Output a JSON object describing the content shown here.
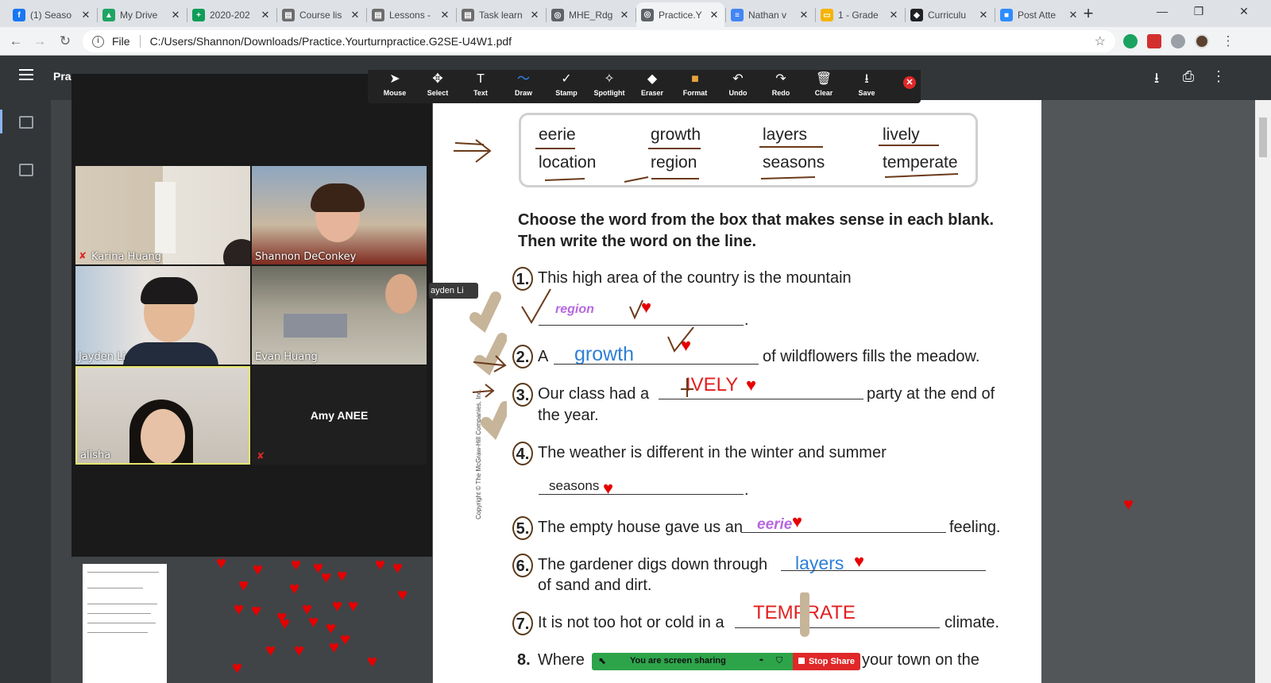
{
  "browser": {
    "tabs": [
      {
        "label": "(1) Seaso",
        "icon": "facebook-icon",
        "color": "#1877f2",
        "glyph": "f"
      },
      {
        "label": "My Drive",
        "icon": "drive-icon",
        "color": "#1fa463",
        "glyph": "▲"
      },
      {
        "label": "2020-202",
        "icon": "sheets-icon",
        "color": "#0f9d58",
        "glyph": "+"
      },
      {
        "label": "Course lis",
        "icon": "page-icon",
        "color": "#6d6d6d",
        "glyph": "▤"
      },
      {
        "label": "Lessons -",
        "icon": "page-icon",
        "color": "#6d6d6d",
        "glyph": "▤"
      },
      {
        "label": "Task learn",
        "icon": "page-icon",
        "color": "#6d6d6d",
        "glyph": "▤"
      },
      {
        "label": "MHE_Rdg",
        "icon": "globe-icon",
        "color": "#5f6368",
        "glyph": "◎"
      },
      {
        "label": "Practice.Y",
        "icon": "globe-icon",
        "color": "#5f6368",
        "glyph": "◎"
      },
      {
        "label": "Nathan v",
        "icon": "docs-icon",
        "color": "#4285f4",
        "glyph": "≡"
      },
      {
        "label": "1 - Grade",
        "icon": "slides-icon",
        "color": "#f4b400",
        "glyph": "▭"
      },
      {
        "label": "Curriculu",
        "icon": "curriculum-icon",
        "color": "#202124",
        "glyph": "◆"
      },
      {
        "label": "Post Atte",
        "icon": "zoom-icon",
        "color": "#2d8cff",
        "glyph": "■"
      }
    ],
    "file_label": "File",
    "url": "C:/Users/Shannon/Downloads/Practice.Yourturnpractice.G2SE-U4W1.pdf"
  },
  "pdf_title": "Prac",
  "zoom": {
    "participants": [
      {
        "name": "Karina Huang",
        "muted": true
      },
      {
        "name": "Shannon DeConkey",
        "muted": false
      },
      {
        "name": "Jayden Li",
        "muted": false
      },
      {
        "name": "Evan Huang",
        "muted": false
      },
      {
        "name": "alisha",
        "muted": false
      },
      {
        "name": "Amy ANEE",
        "muted": true
      }
    ],
    "tooltip": "ayden Li",
    "annotate_tools": [
      {
        "label": "Mouse",
        "icon": "cursor-icon",
        "glyph": "➤"
      },
      {
        "label": "Select",
        "icon": "move-icon",
        "glyph": "✥"
      },
      {
        "label": "Text",
        "icon": "text-icon",
        "glyph": "T"
      },
      {
        "label": "Draw",
        "icon": "draw-icon",
        "glyph": "〜",
        "selected": true
      },
      {
        "label": "Stamp",
        "icon": "check-icon",
        "glyph": "✓"
      },
      {
        "label": "Spotlight",
        "icon": "spotlight-icon",
        "glyph": "✧"
      },
      {
        "label": "Eraser",
        "icon": "eraser-icon",
        "glyph": "◆"
      },
      {
        "label": "Format",
        "icon": "format-icon",
        "glyph": "■"
      },
      {
        "label": "Undo",
        "icon": "undo-icon",
        "glyph": "↶"
      },
      {
        "label": "Redo",
        "icon": "redo-icon",
        "glyph": "↷"
      },
      {
        "label": "Clear",
        "icon": "trash-icon",
        "glyph": "🗑"
      },
      {
        "label": "Save",
        "icon": "save-icon",
        "glyph": "⭳"
      }
    ],
    "sharing_text": "You are screen sharing",
    "stop_share": "Stop Share"
  },
  "worksheet": {
    "words": [
      "eerie",
      "growth",
      "layers",
      "lively",
      "location",
      "region",
      "seasons",
      "temperate"
    ],
    "instructions": "Choose the word from the box that makes sense in each blank. Then write the word on the line.",
    "questions": [
      {
        "num": "1.",
        "before": "This high area of the country is the mountain",
        "after": ".",
        "answer": "region"
      },
      {
        "num": "2.",
        "before": "A",
        "after": "of wildflowers fills the meadow.",
        "answer": "growth"
      },
      {
        "num": "3.",
        "before": "Our class had a",
        "after": "party at the end of",
        "cont": "the year.",
        "answer": "IVELY"
      },
      {
        "num": "4.",
        "before": "The weather is different in the winter and summer",
        "after": ".",
        "answer": "seasons"
      },
      {
        "num": "5.",
        "before": "The empty house gave us an",
        "after": "feeling.",
        "answer": "eerie"
      },
      {
        "num": "6.",
        "before": "The gardener digs down through",
        "after": "",
        "cont": "of sand and dirt.",
        "answer": "layers"
      },
      {
        "num": "7.",
        "before": "It is not too hot or cold in a",
        "after": "climate.",
        "answer": "TEMPRATE"
      },
      {
        "num": "8.",
        "before": "Where",
        "after": "your town on the",
        "answer": ""
      }
    ],
    "copyright": "Copyright © The McGraw-Hill Companies, Inc."
  }
}
